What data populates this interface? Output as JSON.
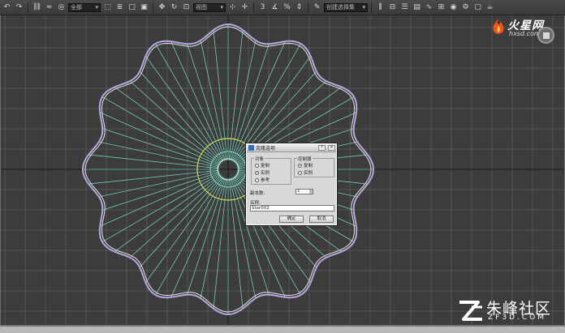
{
  "toolbar": {
    "dropdown_left": "全部",
    "dropdown_view": "视图",
    "dropdown_selection": "创建选择集"
  },
  "dialog": {
    "title": "克隆选项",
    "object_group": "对象",
    "object_options": [
      {
        "label": "复制",
        "selected": false
      },
      {
        "label": "实例",
        "selected": true
      },
      {
        "label": "参考",
        "selected": false
      }
    ],
    "controller_group": "控制器",
    "controller_options": [
      {
        "label": "复制",
        "selected": true
      },
      {
        "label": "实例",
        "selected": false
      }
    ],
    "copies_label": "副本数:",
    "copies_value": "1",
    "name_label": "名称:",
    "name_value": "Star002",
    "ok_label": "确定",
    "cancel_label": "取消",
    "help_label": "?"
  },
  "watermark_top": {
    "name": "火星网",
    "url": "hxsd.com"
  },
  "watermark_bottom": {
    "name": "朱峰社区",
    "url": "ZF3D.COM"
  },
  "colors": {
    "viewport_bg": "#3c3c3c",
    "grid": "#555555",
    "spokes": "#7dd8c8",
    "outer_star": "#b9a6e0",
    "inner_circle": "#d8e35a"
  }
}
